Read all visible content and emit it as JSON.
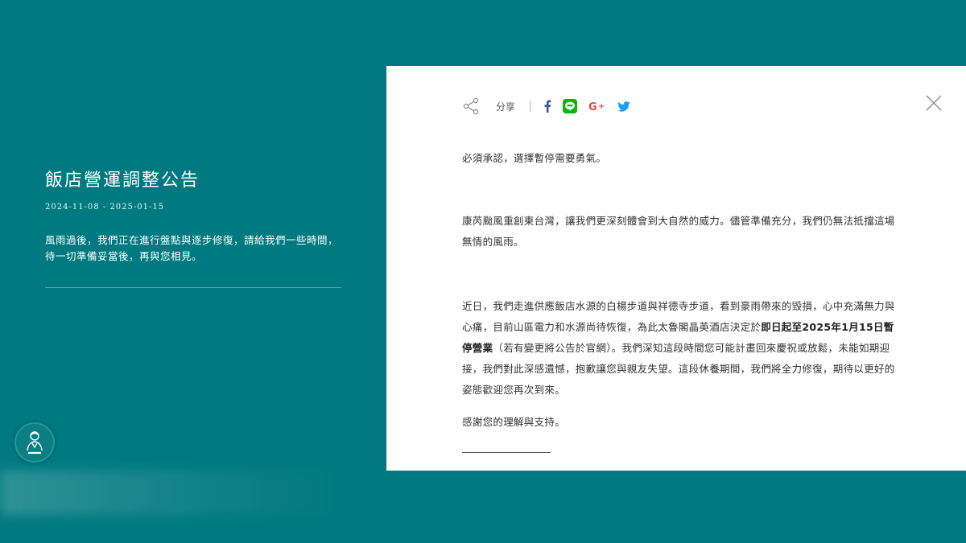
{
  "announcement": {
    "title": "飯店營運調整公告",
    "date_range": "2024-11-08 - 2025-01-15",
    "summary": "風雨過後，我們正在進行盤點與逐步修復，請給我們一些時間，待一切準備妥當後，再與您相見。"
  },
  "share": {
    "label": "分享",
    "networks": [
      "facebook",
      "line",
      "google-plus",
      "twitter"
    ],
    "colors": {
      "facebook": "#3b5998",
      "line": "#00b900",
      "google": "#dd4b39",
      "twitter": "#1da1f2"
    }
  },
  "article": {
    "p1": "必須承認，選擇暫停需要勇氣。",
    "p2": "康芮颱風重創東台灣，讓我們更深刻體會到大自然的威力。儘管準備充分，我們仍無法抵擋這場無情的風雨。",
    "p3_a": "近日，我們走進供應飯店水源的白楊步道與祥德寺步道，看到豪雨帶來的毀損，心中充滿無力與心痛，目前山區電力和水源尚待恢復，為此太魯閣晶英酒店決定於",
    "p3_bold": "即日起至2025年1月15日暫停營業",
    "p3_b": "（若有變更將公告於官網）。我們深知這段時間您可能計畫回來慶祝或放鬆，未能如期迎接，我們對此深感遺憾，抱歉讓您與親友失望。這段休養期間，我們將全力修復，期待以更好的姿態歡迎您再次到來。",
    "p4": "感謝您的理解與支持。"
  },
  "colors": {
    "background": "#007a80",
    "modal": "#ffffff"
  }
}
